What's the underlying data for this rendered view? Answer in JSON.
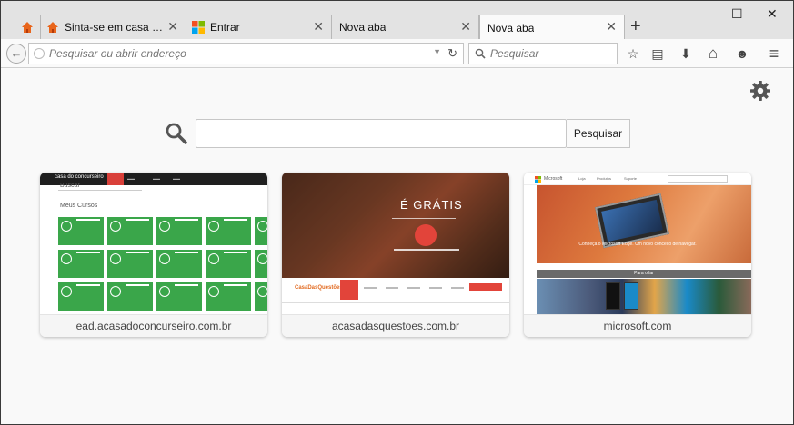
{
  "browser": {
    "tabs": [
      {
        "title": "",
        "close": "",
        "favicon": "home-orange-icon",
        "active": false
      },
      {
        "title": "Sinta-se em casa para...",
        "close": "✕",
        "favicon": "home-orange-icon",
        "active": false
      },
      {
        "title": "Entrar",
        "close": "✕",
        "favicon": "windows-logo-icon",
        "active": false
      },
      {
        "title": "Nova aba",
        "close": "✕",
        "favicon": "",
        "active": false
      },
      {
        "title": "Nova aba",
        "close": "✕",
        "favicon": "",
        "active": true
      }
    ],
    "new_tab_label": "+",
    "window_controls": {
      "minimize": "—",
      "maximize": "☐",
      "close": "✕"
    },
    "back_label": "←",
    "url_placeholder": "Pesquisar ou abrir endereço",
    "url_dropdown": "▼",
    "reload_label": "↻",
    "search_placeholder": "Pesquisar",
    "toolbar_icons": [
      "bookmark-star-icon",
      "reading-list-icon",
      "download-icon",
      "home-icon",
      "hello-chat-icon",
      "hamburger-menu-icon"
    ],
    "toolbar_glyphs": [
      "☆",
      "▤",
      "⬇",
      "⌂",
      "☻",
      "≡"
    ]
  },
  "newtab": {
    "search_button_label": "Pesquisar",
    "settings_icon": "gear-icon",
    "tiles": [
      {
        "label": "ead.acasadoconcurseiro.com.br",
        "thumb": {
          "logo": "casa do concurseiro",
          "buscar": "Buscar",
          "meus_cursos": "Meus Cursos"
        }
      },
      {
        "label": "acasadasquestoes.com.br",
        "thumb": {
          "headline": "É GRÁTIS",
          "logo": "CasaDasQuestões"
        }
      },
      {
        "label": "microsoft.com",
        "thumb": {
          "brand": "Microsoft",
          "menu": [
            "Loja",
            "Produtos",
            "Suporte"
          ],
          "hero_text": "Conheça o Microsoft Edge. Um novo conceito de navegar.",
          "section": "Para o lar"
        }
      }
    ]
  },
  "colors": {
    "tabstrip": "#e3e3e3",
    "accent_red": "#e2443a",
    "tile_green": "#3aa64a"
  }
}
